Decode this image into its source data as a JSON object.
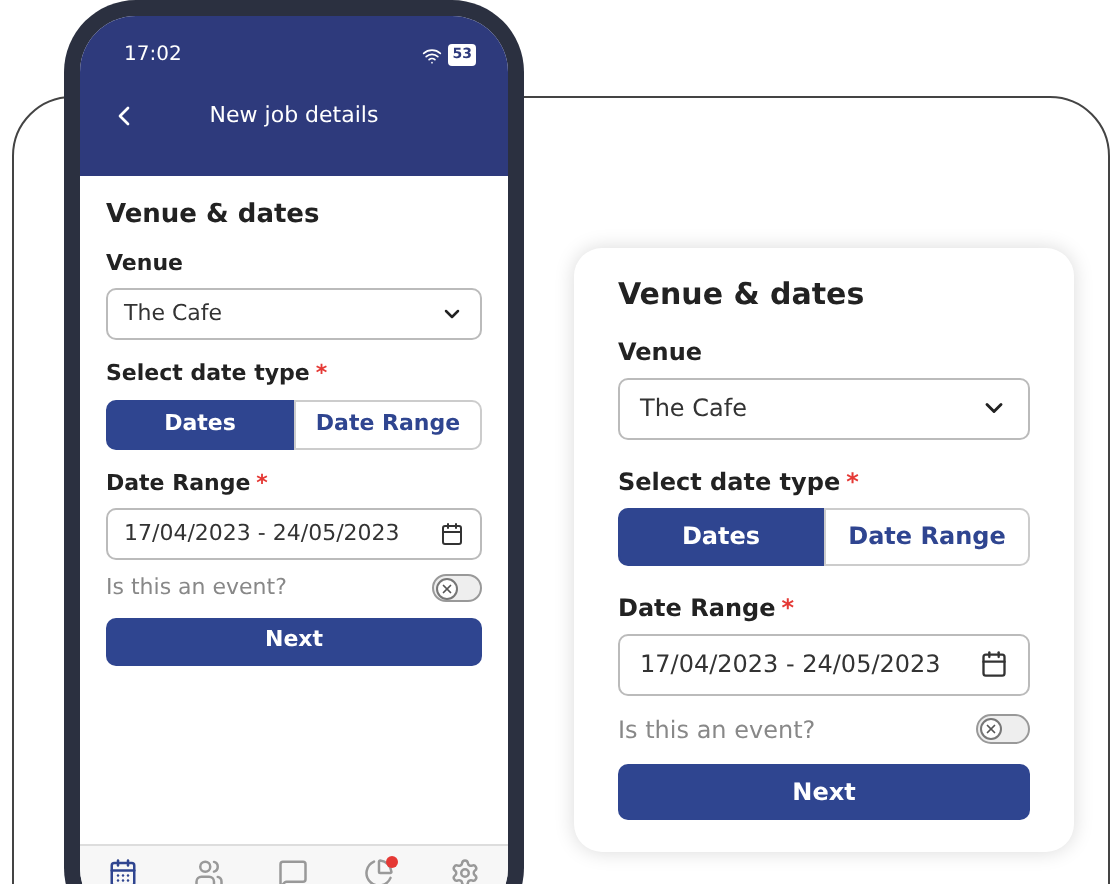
{
  "phone": {
    "status_bar": {
      "time": "17:02",
      "battery": "53"
    },
    "header": {
      "title": "New job details"
    },
    "form": {
      "title": "Venue & dates",
      "venue_label": "Venue",
      "venue_value": "The Cafe",
      "date_type_label": "Select date type",
      "required_mark": "*",
      "date_types": [
        {
          "label": "Dates",
          "selected": true
        },
        {
          "label": "Date Range",
          "selected": false
        }
      ],
      "date_range_label": "Date Range",
      "date_range_value": "17/04/2023 - 24/05/2023",
      "event_label": "Is this an event?",
      "event_on": false,
      "next_button": "Next"
    },
    "bottom_nav": [
      {
        "kind": "calendar",
        "selected": true,
        "badge": false
      },
      {
        "kind": "people",
        "selected": false,
        "badge": false
      },
      {
        "kind": "chat",
        "selected": false,
        "badge": false
      },
      {
        "kind": "stats",
        "selected": false,
        "badge": true
      },
      {
        "kind": "settings",
        "selected": false,
        "badge": false
      }
    ]
  },
  "card": {
    "form": {
      "title": "Venue & dates",
      "venue_label": "Venue",
      "venue_value": "The Cafe",
      "date_type_label": "Select date type",
      "required_mark": "*",
      "date_types": [
        {
          "label": "Dates",
          "selected": true
        },
        {
          "label": "Date Range",
          "selected": false
        }
      ],
      "date_range_label": "Date Range",
      "date_range_value": "17/04/2023 - 24/05/2023",
      "event_label": "Is this an event?",
      "event_on": false,
      "next_button": "Next"
    }
  }
}
